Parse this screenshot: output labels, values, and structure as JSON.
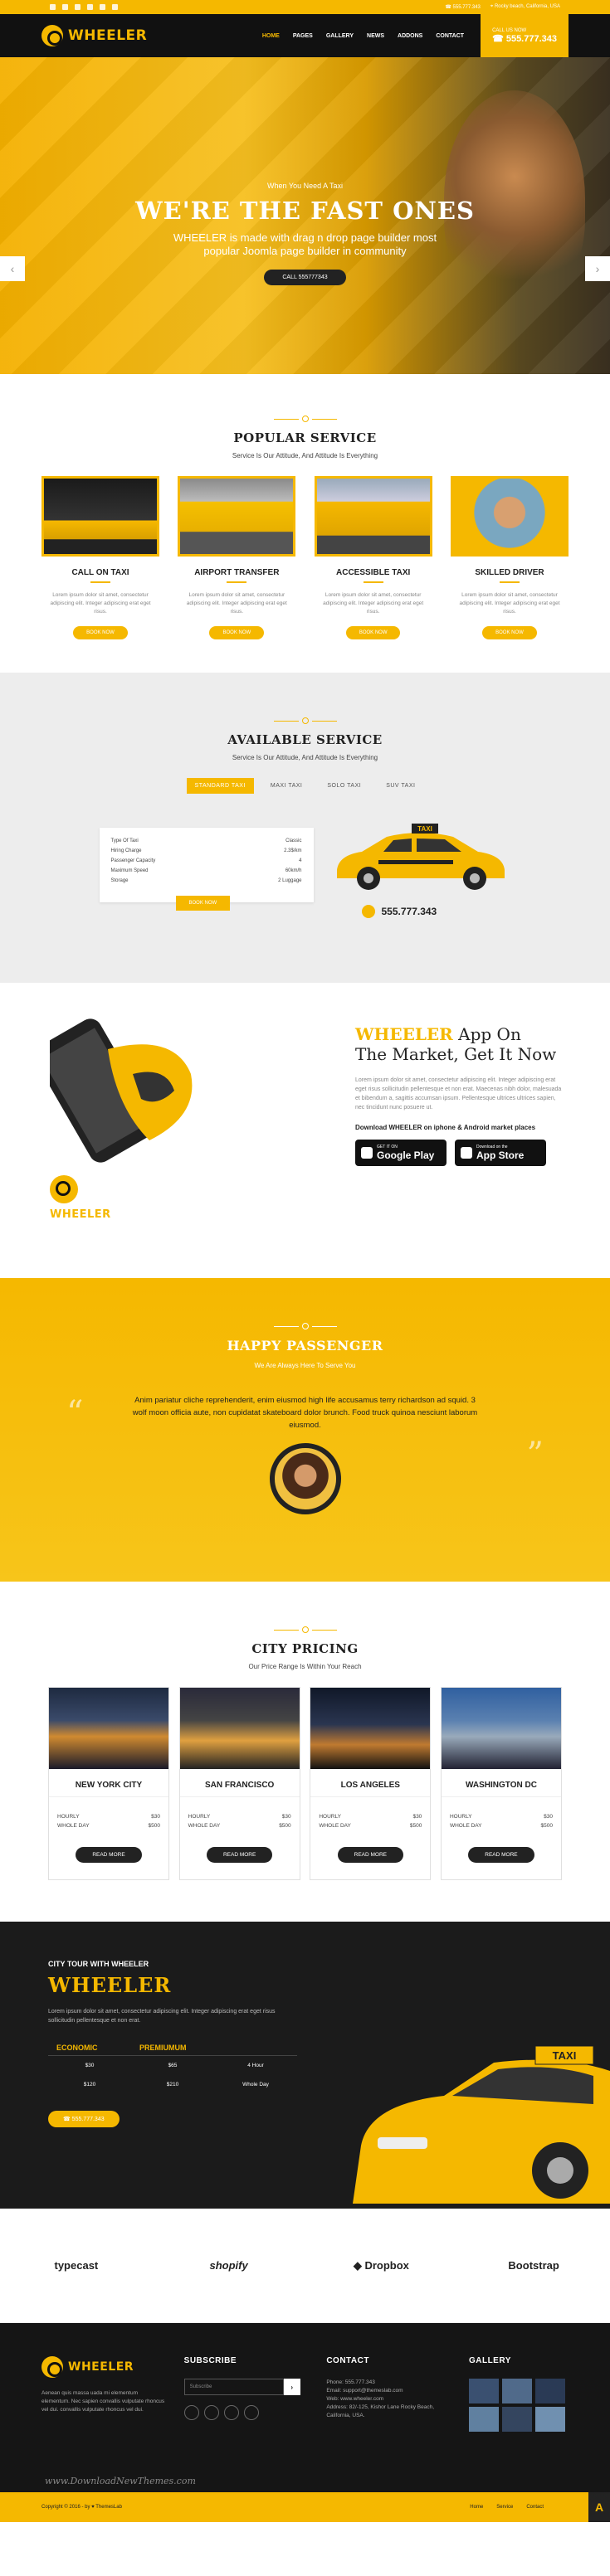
{
  "topbar": {
    "phone": "555.777.343",
    "address": "Rocky beach, California, USA",
    "social": [
      "facebook-icon",
      "twitter-icon",
      "google-plus-icon",
      "instagram-icon",
      "linkedin-icon",
      "youtube-icon"
    ]
  },
  "brand": {
    "name": "WHEELER",
    "accent": "#f5b800",
    "dark": "#111111"
  },
  "nav": {
    "items": [
      "HOME",
      "PAGES",
      "GALLERY",
      "NEWS",
      "ADDONS",
      "CONTACT"
    ],
    "call_label": "CALL US NOW",
    "call_number": "555.777.343"
  },
  "hero": {
    "pre": "When You Need A Taxi",
    "title": "WE'RE THE FAST ONES",
    "text": "WHEELER is made with drag n drop page builder most popular Joomla page builder in community",
    "button": "CALL 555777343"
  },
  "popular": {
    "title": "POPULAR SERVICE",
    "subtitle": "Service Is Our Attitude, And Attitude Is Everything",
    "cards": [
      {
        "title": "CALL ON TAXI",
        "text": "Lorem ipsum dolor sit amet, consectetur adipiscing elit. Integer adipiscing erat eget risus.",
        "button": "BOOK NOW"
      },
      {
        "title": "AIRPORT TRANSFER",
        "text": "Lorem ipsum dolor sit amet, consectetur adipiscing elit. Integer adipiscing erat eget risus.",
        "button": "BOOK NOW"
      },
      {
        "title": "ACCESSIBLE TAXI",
        "text": "Lorem ipsum dolor sit amet, consectetur adipiscing elit. Integer adipiscing erat eget risus.",
        "button": "BOOK NOW"
      },
      {
        "title": "SKILLED DRIVER",
        "text": "Lorem ipsum dolor sit amet, consectetur adipiscing elit. Integer adipiscing erat eget risus.",
        "button": "BOOK NOW"
      }
    ]
  },
  "available": {
    "title": "AVAILABLE SERVICE",
    "subtitle": "Service Is Our Attitude, And Attitude Is Everything",
    "tabs": [
      "STANDARD TAXI",
      "MAXI TAXI",
      "SOLO TAXI",
      "SUV TAXI"
    ],
    "specs": [
      {
        "k": "Type Of Taxi",
        "v": "Classic"
      },
      {
        "k": "Hiring Charge",
        "v": "2.3$/km"
      },
      {
        "k": "Passenger Capacity",
        "v": "4"
      },
      {
        "k": "Maximum Speed",
        "v": "60km/h"
      },
      {
        "k": "Storage",
        "v": "2 Luggage"
      }
    ],
    "button": "BOOK NOW",
    "phone": "555.777.343",
    "taxi_sign": "TAXI"
  },
  "app": {
    "brand": "WHEELER",
    "title_rest": "App On",
    "title_line2": "The Market, Get It Now",
    "text": "Lorem ipsum dolor sit amet, consectetur adipiscing elit. Integer adipiscing erat eget risus sollicitudin pellentesque et non erat. Maecenas nibh dolor, malesuada et bibendum a, sagittis accumsan ipsum. Pellentesque ultrices ultrices sapien, nec tincidunt nunc posuere ut.",
    "download": "Download WHEELER on iphone & Android market places",
    "google_small": "GET IT ON",
    "google": "Google Play",
    "apple_small": "Download on the",
    "apple": "App Store",
    "logo_text": "WHEELER"
  },
  "passenger": {
    "title": "HAPPY PASSENGER",
    "subtitle": "We Are Always Here To Serve You",
    "quote": "Anim pariatur cliche reprehenderit, enim eiusmod high life accusamus terry richardson ad squid. 3 wolf moon officia aute, non cupidatat skateboard dolor brunch. Food truck quinoa nesciunt laborum eiusmod."
  },
  "pricing": {
    "title": "CITY PRICING",
    "subtitle": "Our Price Range Is Within Your Reach",
    "cities": [
      {
        "name": "NEW YORK CITY",
        "hourly": "$30",
        "whole": "$500",
        "button": "READ MORE"
      },
      {
        "name": "SAN FRANCISCO",
        "hourly": "$30",
        "whole": "$500",
        "button": "READ MORE"
      },
      {
        "name": "LOS ANGELES",
        "hourly": "$30",
        "whole": "$500",
        "button": "READ MORE"
      },
      {
        "name": "WASHINGTON DC",
        "hourly": "$30",
        "whole": "$500",
        "button": "READ MORE"
      }
    ],
    "hourly_label": "HOURLY",
    "whole_label": "WHOLE DAY"
  },
  "tour": {
    "pre": "CITY TOUR WITH WHEELER",
    "title": "WHEELER",
    "text": "Lorem ipsum dolor sit amet, consectetur adipiscing elit. Integer adipiscing erat eget risus sollicitudin pellentesque et non erat.",
    "headers": [
      "ECONOMIC",
      "PREMIUMUM",
      ""
    ],
    "rows": [
      [
        "$30",
        "$65",
        "4 Hour"
      ],
      [
        "$120",
        "$210",
        "Whole Day"
      ]
    ],
    "button": "555.777.343",
    "taxi_sign": "TAXI"
  },
  "brands": [
    "typecast",
    "shopify",
    "Dropbox",
    "Bootstrap"
  ],
  "footer": {
    "about": "Aenean quis massa uada mi elementum elementum. Nec sapien convallis vulputate rhoncus vel dui. convallis vulputate rhoncus vel dui.",
    "subscribe_title": "SUBSCRIBE",
    "subscribe_placeholder": "Subscribe",
    "contact_title": "CONTACT",
    "contact": [
      "Phone: 555.777.343",
      "Email: support@themeslab.com",
      "Web: www.wheeler.com",
      "Address: 82/-125, Kishor Lane Rocky Beach, California, USA."
    ],
    "gallery_title": "GALLERY",
    "watermark": "www.DownloadNewThemes.com"
  },
  "bottom": {
    "copyright": "Copyright © 2016 - by ♥ ThemesLab",
    "links": [
      "Home",
      "Service",
      "Contact"
    ]
  }
}
